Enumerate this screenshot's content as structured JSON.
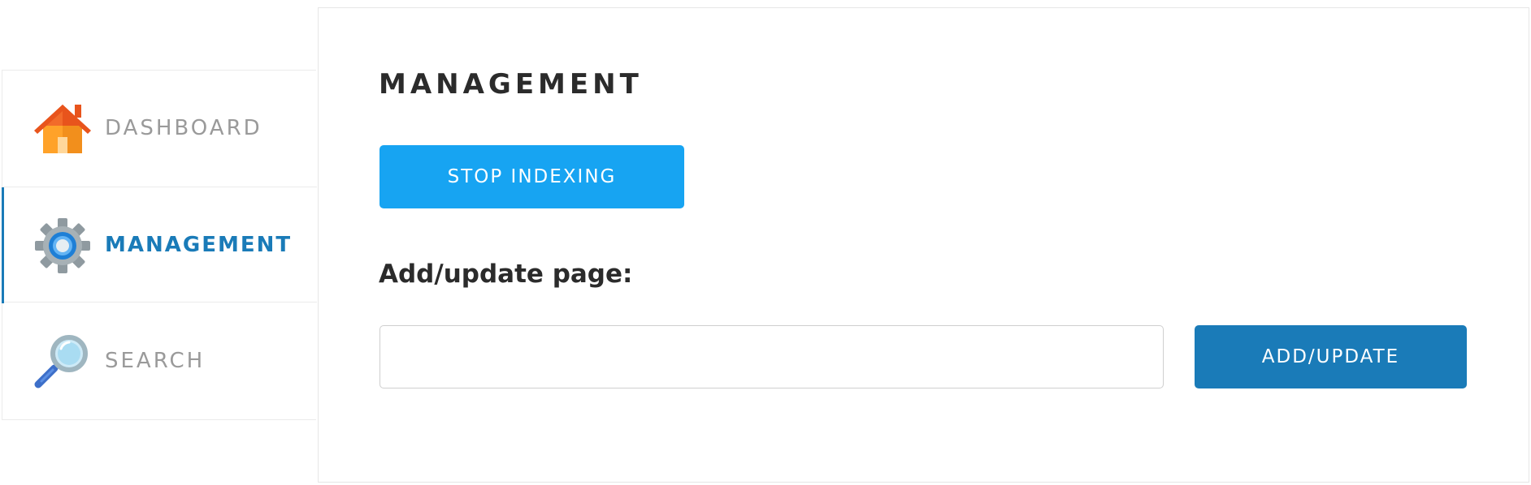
{
  "sidebar": {
    "items": [
      {
        "label": "DASHBOARD",
        "icon": "home-icon",
        "active": false
      },
      {
        "label": "MANAGEMENT",
        "icon": "gear-icon",
        "active": true
      },
      {
        "label": "SEARCH",
        "icon": "magnifier-icon",
        "active": false
      }
    ]
  },
  "main": {
    "title": "MANAGEMENT",
    "stop_indexing_label": "STOP INDEXING",
    "add_page_label": "Add/update page:",
    "page_input_value": "",
    "page_input_placeholder": "",
    "add_update_label": "ADD/UPDATE"
  },
  "colors": {
    "accent": "#1a7bb8",
    "stop_button": "#17a4f2",
    "inactive_text": "#9a9a9a",
    "heading_text": "#2b2b2b"
  }
}
